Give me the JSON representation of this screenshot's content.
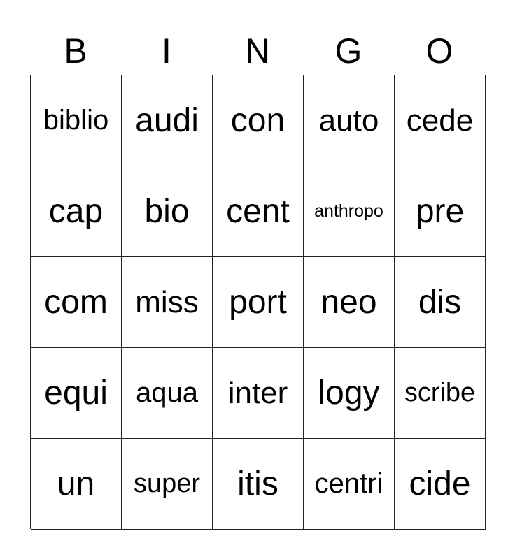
{
  "header": [
    "B",
    "I",
    "N",
    "G",
    "O"
  ],
  "rows": [
    [
      "biblio",
      "audi",
      "con",
      "auto",
      "cede"
    ],
    [
      "cap",
      "bio",
      "cent",
      "anthropo",
      "pre"
    ],
    [
      "com",
      "miss",
      "port",
      "neo",
      "dis"
    ],
    [
      "equi",
      "aqua",
      "inter",
      "logy",
      "scribe"
    ],
    [
      "un",
      "super",
      "itis",
      "centri",
      "cide"
    ]
  ]
}
